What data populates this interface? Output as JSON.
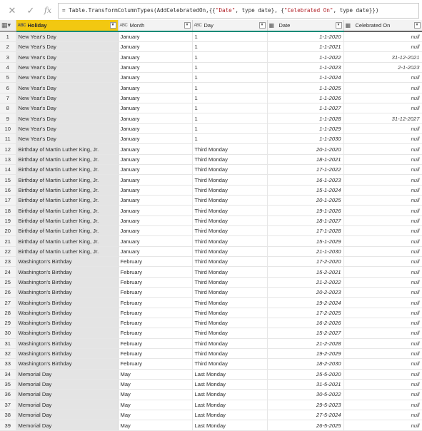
{
  "formula": {
    "prefix": "= Table.TransformColumnTypes(AddCelebratedOn,{{",
    "str1": "\"Date\"",
    "mid1": ", type date}, {",
    "str2": "\"Celebrated On\"",
    "mid2": ", type date}})",
    "cancel_icon": "close-icon",
    "commit_icon": "check-icon",
    "fx_label": "fx"
  },
  "columns": [
    {
      "label": "Holiday",
      "type_glyph": "ABC",
      "icon": "text-type-icon"
    },
    {
      "label": "Month",
      "type_glyph": "ABC",
      "icon": "text-type-icon"
    },
    {
      "label": "Day",
      "type_glyph": "ABC",
      "icon": "text-type-icon"
    },
    {
      "label": "Date",
      "type_glyph": "▦",
      "icon": "date-type-icon"
    },
    {
      "label": "Celebrated On",
      "type_glyph": "▦",
      "icon": "date-type-icon"
    }
  ],
  "rows": [
    [
      "1",
      "New Year's Day",
      "January",
      "1",
      "1-1-2020",
      "null"
    ],
    [
      "2",
      "New Year's Day",
      "January",
      "1",
      "1-1-2021",
      "null"
    ],
    [
      "3",
      "New Year's Day",
      "January",
      "1",
      "1-1-2022",
      "31-12-2021"
    ],
    [
      "4",
      "New Year's Day",
      "January",
      "1",
      "1-1-2023",
      "2-1-2023"
    ],
    [
      "5",
      "New Year's Day",
      "January",
      "1",
      "1-1-2024",
      "null"
    ],
    [
      "6",
      "New Year's Day",
      "January",
      "1",
      "1-1-2025",
      "null"
    ],
    [
      "7",
      "New Year's Day",
      "January",
      "1",
      "1-1-2026",
      "null"
    ],
    [
      "8",
      "New Year's Day",
      "January",
      "1",
      "1-1-2027",
      "null"
    ],
    [
      "9",
      "New Year's Day",
      "January",
      "1",
      "1-1-2028",
      "31-12-2027"
    ],
    [
      "10",
      "New Year's Day",
      "January",
      "1",
      "1-1-2029",
      "null"
    ],
    [
      "11",
      "New Year's Day",
      "January",
      "1",
      "1-1-2030",
      "null"
    ],
    [
      "12",
      "Birthday of Martin Luther King, Jr.",
      "January",
      "Third Monday",
      "20-1-2020",
      "null"
    ],
    [
      "13",
      "Birthday of Martin Luther King, Jr.",
      "January",
      "Third Monday",
      "18-1-2021",
      "null"
    ],
    [
      "14",
      "Birthday of Martin Luther King, Jr.",
      "January",
      "Third Monday",
      "17-1-2022",
      "null"
    ],
    [
      "15",
      "Birthday of Martin Luther King, Jr.",
      "January",
      "Third Monday",
      "16-1-2023",
      "null"
    ],
    [
      "16",
      "Birthday of Martin Luther King, Jr.",
      "January",
      "Third Monday",
      "15-1-2024",
      "null"
    ],
    [
      "17",
      "Birthday of Martin Luther King, Jr.",
      "January",
      "Third Monday",
      "20-1-2025",
      "null"
    ],
    [
      "18",
      "Birthday of Martin Luther King, Jr.",
      "January",
      "Third Monday",
      "19-1-2026",
      "null"
    ],
    [
      "19",
      "Birthday of Martin Luther King, Jr.",
      "January",
      "Third Monday",
      "18-1-2027",
      "null"
    ],
    [
      "20",
      "Birthday of Martin Luther King, Jr.",
      "January",
      "Third Monday",
      "17-1-2028",
      "null"
    ],
    [
      "21",
      "Birthday of Martin Luther King, Jr.",
      "January",
      "Third Monday",
      "15-1-2029",
      "null"
    ],
    [
      "22",
      "Birthday of Martin Luther King, Jr.",
      "January",
      "Third Monday",
      "21-1-2030",
      "null"
    ],
    [
      "23",
      "Washington's Birthday",
      "February",
      "Third Monday",
      "17-2-2020",
      "null"
    ],
    [
      "24",
      "Washington's Birthday",
      "February",
      "Third Monday",
      "15-2-2021",
      "null"
    ],
    [
      "25",
      "Washington's Birthday",
      "February",
      "Third Monday",
      "21-2-2022",
      "null"
    ],
    [
      "26",
      "Washington's Birthday",
      "February",
      "Third Monday",
      "20-2-2023",
      "null"
    ],
    [
      "27",
      "Washington's Birthday",
      "February",
      "Third Monday",
      "19-2-2024",
      "null"
    ],
    [
      "28",
      "Washington's Birthday",
      "February",
      "Third Monday",
      "17-2-2025",
      "null"
    ],
    [
      "29",
      "Washington's Birthday",
      "February",
      "Third Monday",
      "16-2-2026",
      "null"
    ],
    [
      "30",
      "Washington's Birthday",
      "February",
      "Third Monday",
      "15-2-2027",
      "null"
    ],
    [
      "31",
      "Washington's Birthday",
      "February",
      "Third Monday",
      "21-2-2028",
      "null"
    ],
    [
      "32",
      "Washington's Birthday",
      "February",
      "Third Monday",
      "19-2-2029",
      "null"
    ],
    [
      "33",
      "Washington's Birthday",
      "February",
      "Third Monday",
      "18-2-2030",
      "null"
    ],
    [
      "34",
      "Memorial Day",
      "May",
      "Last Monday",
      "25-5-2020",
      "null"
    ],
    [
      "35",
      "Memorial Day",
      "May",
      "Last Monday",
      "31-5-2021",
      "null"
    ],
    [
      "36",
      "Memorial Day",
      "May",
      "Last Monday",
      "30-5-2022",
      "null"
    ],
    [
      "37",
      "Memorial Day",
      "May",
      "Last Monday",
      "29-5-2023",
      "null"
    ],
    [
      "38",
      "Memorial Day",
      "May",
      "Last Monday",
      "27-5-2024",
      "null"
    ],
    [
      "39",
      "Memorial Day",
      "May",
      "Last Monday",
      "26-5-2025",
      "null"
    ]
  ],
  "colors": {
    "selected_header": "#f2c811",
    "quality_bar": "#0d8a77"
  }
}
